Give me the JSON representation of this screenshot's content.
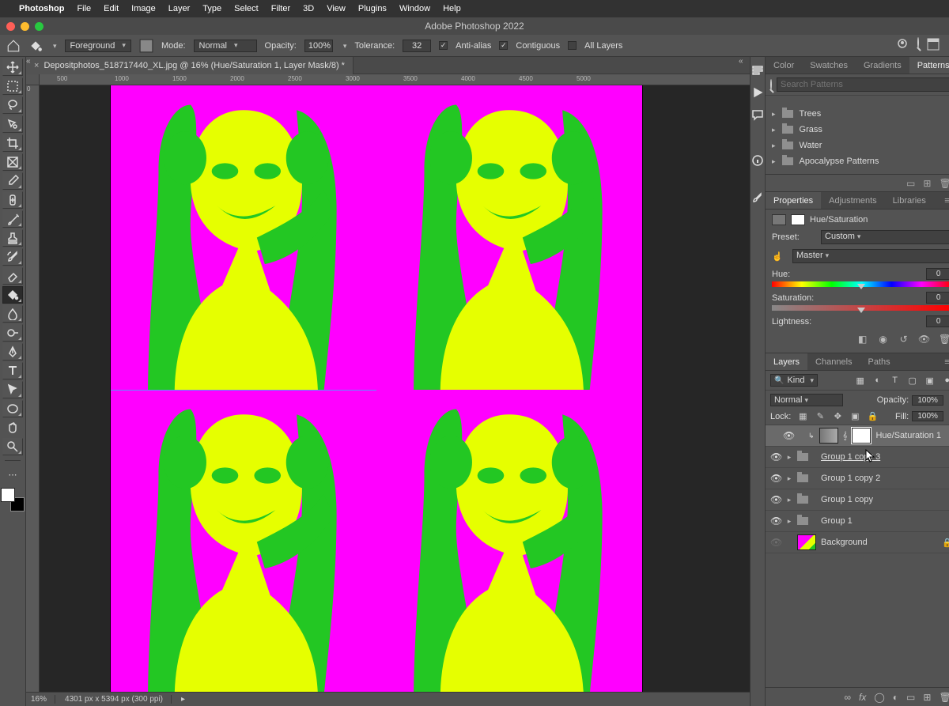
{
  "menubar": {
    "app": "Photoshop",
    "items": [
      "File",
      "Edit",
      "Image",
      "Layer",
      "Type",
      "Select",
      "Filter",
      "3D",
      "View",
      "Plugins",
      "Window",
      "Help"
    ]
  },
  "window_title": "Adobe Photoshop 2022",
  "options": {
    "fill_label": "Foreground",
    "mode_label": "Mode:",
    "mode_value": "Normal",
    "opacity_label": "Opacity:",
    "opacity_value": "100%",
    "tolerance_label": "Tolerance:",
    "tolerance_value": "32",
    "antialias": "Anti-alias",
    "contiguous": "Contiguous",
    "all_layers": "All Layers"
  },
  "document": {
    "tab_title": "Depositphotos_518717440_XL.jpg @ 16% (Hue/Saturation 1, Layer Mask/8) *",
    "ruler_h": [
      "500",
      "1000",
      "1500",
      "2000",
      "2500",
      "3000",
      "3500",
      "4000",
      "4500",
      "5000"
    ],
    "ruler_v": [
      "0"
    ]
  },
  "status": {
    "zoom": "16%",
    "dims": "4301 px x 5394 px (300 ppi)"
  },
  "panel_tabs_top": [
    "Color",
    "Swatches",
    "Gradients",
    "Patterns"
  ],
  "patterns": {
    "search_placeholder": "Search Patterns",
    "groups": [
      "Trees",
      "Grass",
      "Water",
      "Apocalypse Patterns"
    ]
  },
  "panel_tabs_mid": [
    "Properties",
    "Adjustments",
    "Libraries"
  ],
  "properties": {
    "title": "Hue/Saturation",
    "preset_label": "Preset:",
    "preset_value": "Custom",
    "channel_value": "Master",
    "hue_label": "Hue:",
    "hue_value": "0",
    "sat_label": "Saturation:",
    "sat_value": "0",
    "light_label": "Lightness:",
    "light_value": "0"
  },
  "panel_tabs_bot": [
    "Layers",
    "Channels",
    "Paths"
  ],
  "layers_panel": {
    "kind_label": "Kind",
    "blend_mode": "Normal",
    "opacity_label": "Opacity:",
    "opacity_value": "100%",
    "lock_label": "Lock:",
    "fill_label": "Fill:",
    "fill_value": "100%",
    "items": [
      {
        "name": "Hue/Saturation 1",
        "type": "adj",
        "selected": true
      },
      {
        "name": "Group 1 copy 3",
        "type": "group",
        "underline": true
      },
      {
        "name": "Group 1 copy 2",
        "type": "group"
      },
      {
        "name": "Group 1 copy",
        "type": "group"
      },
      {
        "name": "Group 1",
        "type": "group"
      },
      {
        "name": "Background",
        "type": "bg",
        "locked": true
      }
    ]
  }
}
